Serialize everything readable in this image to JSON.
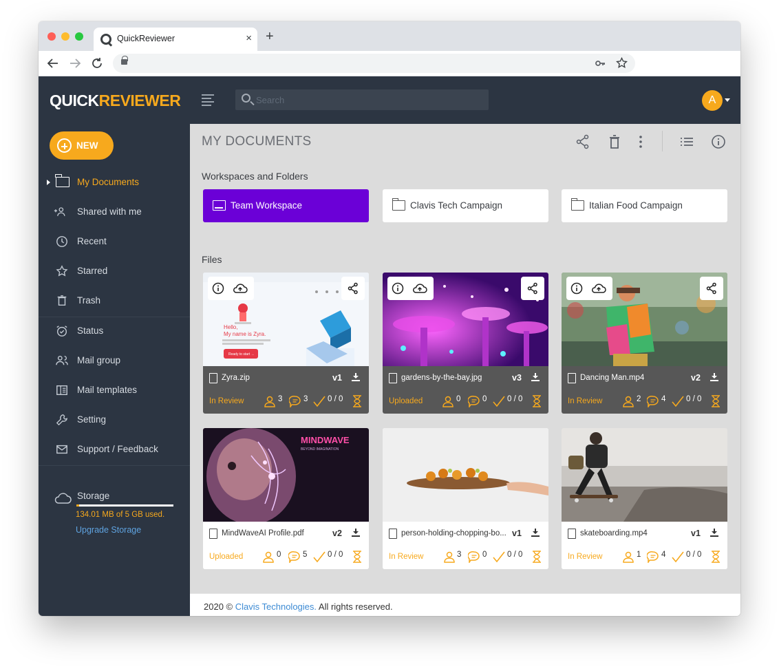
{
  "browser": {
    "tab_title": "QuickReviewer",
    "close_glyph": "×",
    "new_tab_glyph": "+"
  },
  "header": {
    "logo_part1": "QUICK",
    "logo_part2": "REVIEWER",
    "search_placeholder": "Search",
    "avatar_initial": "A"
  },
  "sidebar": {
    "new_label": "NEW",
    "items": [
      {
        "label": "My Documents",
        "icon": "folder-icon"
      },
      {
        "label": "Shared with me",
        "icon": "shared-users-icon"
      },
      {
        "label": "Recent",
        "icon": "clock-icon"
      },
      {
        "label": "Starred",
        "icon": "star-icon"
      },
      {
        "label": "Trash",
        "icon": "trash-icon"
      },
      {
        "label": "Status",
        "icon": "alarm-check-icon"
      },
      {
        "label": "Mail group",
        "icon": "group-icon"
      },
      {
        "label": "Mail templates",
        "icon": "template-icon"
      },
      {
        "label": "Setting",
        "icon": "wrench-icon"
      },
      {
        "label": "Support / Feedback",
        "icon": "mail-icon"
      }
    ],
    "storage": {
      "label": "Storage",
      "used_text": "134.01 MB of 5 GB used.",
      "used_fraction": 0.026,
      "upgrade_label": "Upgrade Storage"
    }
  },
  "main": {
    "title": "MY DOCUMENTS",
    "workspaces_heading": "Workspaces and Folders",
    "files_heading": "Files",
    "workspaces": [
      {
        "label": "Team Workspace",
        "active": true
      },
      {
        "label": "Clavis Tech Campaign",
        "active": false
      },
      {
        "label": "Italian Food Campaign",
        "active": false
      }
    ],
    "files": [
      {
        "name": "Zyra.zip",
        "version": "v1",
        "status": "In Review",
        "reviewers": "3",
        "comments": "3",
        "approvals": "0 / 0",
        "hover": true
      },
      {
        "name": "gardens-by-the-bay.jpg",
        "version": "v3",
        "status": "Uploaded",
        "reviewers": "0",
        "comments": "0",
        "approvals": "0 / 0",
        "hover": true
      },
      {
        "name": "Dancing Man.mp4",
        "version": "v2",
        "status": "In Review",
        "reviewers": "2",
        "comments": "4",
        "approvals": "0 / 0",
        "hover": true
      },
      {
        "name": "MindWaveAI Profile.pdf",
        "version": "v2",
        "status": "Uploaded",
        "reviewers": "0",
        "comments": "5",
        "approvals": "0 / 0",
        "hover": false
      },
      {
        "name": "person-holding-chopping-bo...",
        "version": "v1",
        "status": "In Review",
        "reviewers": "3",
        "comments": "0",
        "approvals": "0 / 0",
        "hover": false
      },
      {
        "name": "skateboarding.mp4",
        "version": "v1",
        "status": "In Review",
        "reviewers": "1",
        "comments": "4",
        "approvals": "0 / 0",
        "hover": false
      }
    ],
    "thumb_text": {
      "zyra_line1": "Hello,",
      "zyra_line2": "My name is Zyra.",
      "zyra_button": "Ready to start →",
      "mindwave_title": "MINDWAVE",
      "mindwave_sub": "BEYOND IMAGINATION"
    }
  },
  "footer": {
    "prefix": "2020 © ",
    "link": "Clavis Technologies.",
    "suffix": " All rights reserved."
  },
  "colors": {
    "accent": "#f7a91d",
    "header_bg": "#2c3542",
    "active_workspace": "#6b00d7",
    "link": "#3d8bd4"
  }
}
